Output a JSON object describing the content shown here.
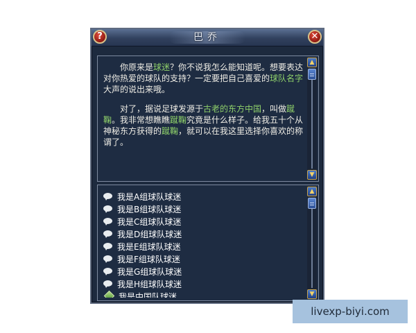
{
  "window": {
    "title": "巴乔",
    "help_label": "?",
    "close_label": "✕"
  },
  "dialog": {
    "paragraphs": [
      {
        "segments": [
          {
            "text": "你原来是",
            "highlight": false
          },
          {
            "text": "球迷",
            "highlight": true
          },
          {
            "text": "？你不说我怎么能知道呢。想要表达对你热爱的球队的支持？一定要把自己喜爱的",
            "highlight": false
          },
          {
            "text": "球队名字",
            "highlight": true
          },
          {
            "text": "大声的说出来哦。",
            "highlight": false
          }
        ]
      },
      {
        "segments": [
          {
            "text": "对了，据说足球发源于",
            "highlight": false
          },
          {
            "text": "古老的东方中国",
            "highlight": true
          },
          {
            "text": "，叫做",
            "highlight": false
          },
          {
            "text": "蹴鞠",
            "highlight": true
          },
          {
            "text": "。我非常想瞧瞧",
            "highlight": false
          },
          {
            "text": "蹴鞠",
            "highlight": true
          },
          {
            "text": "究竟是什么样子。给我五十个从神秘东方获得的",
            "highlight": false
          },
          {
            "text": "蹴鞠",
            "highlight": true
          },
          {
            "text": "，就可以在我这里选择你喜欢的称谓了。",
            "highlight": false
          }
        ]
      }
    ],
    "highlight_color": "#8fd06a",
    "text_color": "#f0eee6"
  },
  "options": [
    {
      "label": "我是A组球队球迷",
      "icon": "speech-bubble-icon"
    },
    {
      "label": "我是B组球队球迷",
      "icon": "speech-bubble-icon"
    },
    {
      "label": "我是C组球队球迷",
      "icon": "speech-bubble-icon"
    },
    {
      "label": "我是D组球队球迷",
      "icon": "speech-bubble-icon"
    },
    {
      "label": "我是E组球队球迷",
      "icon": "speech-bubble-icon"
    },
    {
      "label": "我是F组球队球迷",
      "icon": "speech-bubble-icon"
    },
    {
      "label": "我是G组球队球迷",
      "icon": "speech-bubble-icon"
    },
    {
      "label": "我是H组球队球迷",
      "icon": "speech-bubble-icon"
    },
    {
      "label": "我是中国队球迷",
      "icon": "diamond-icon"
    }
  ],
  "scroll": {
    "up_glyph": "▲",
    "down_glyph": "▼"
  },
  "watermark": "livexp-biyi.com"
}
